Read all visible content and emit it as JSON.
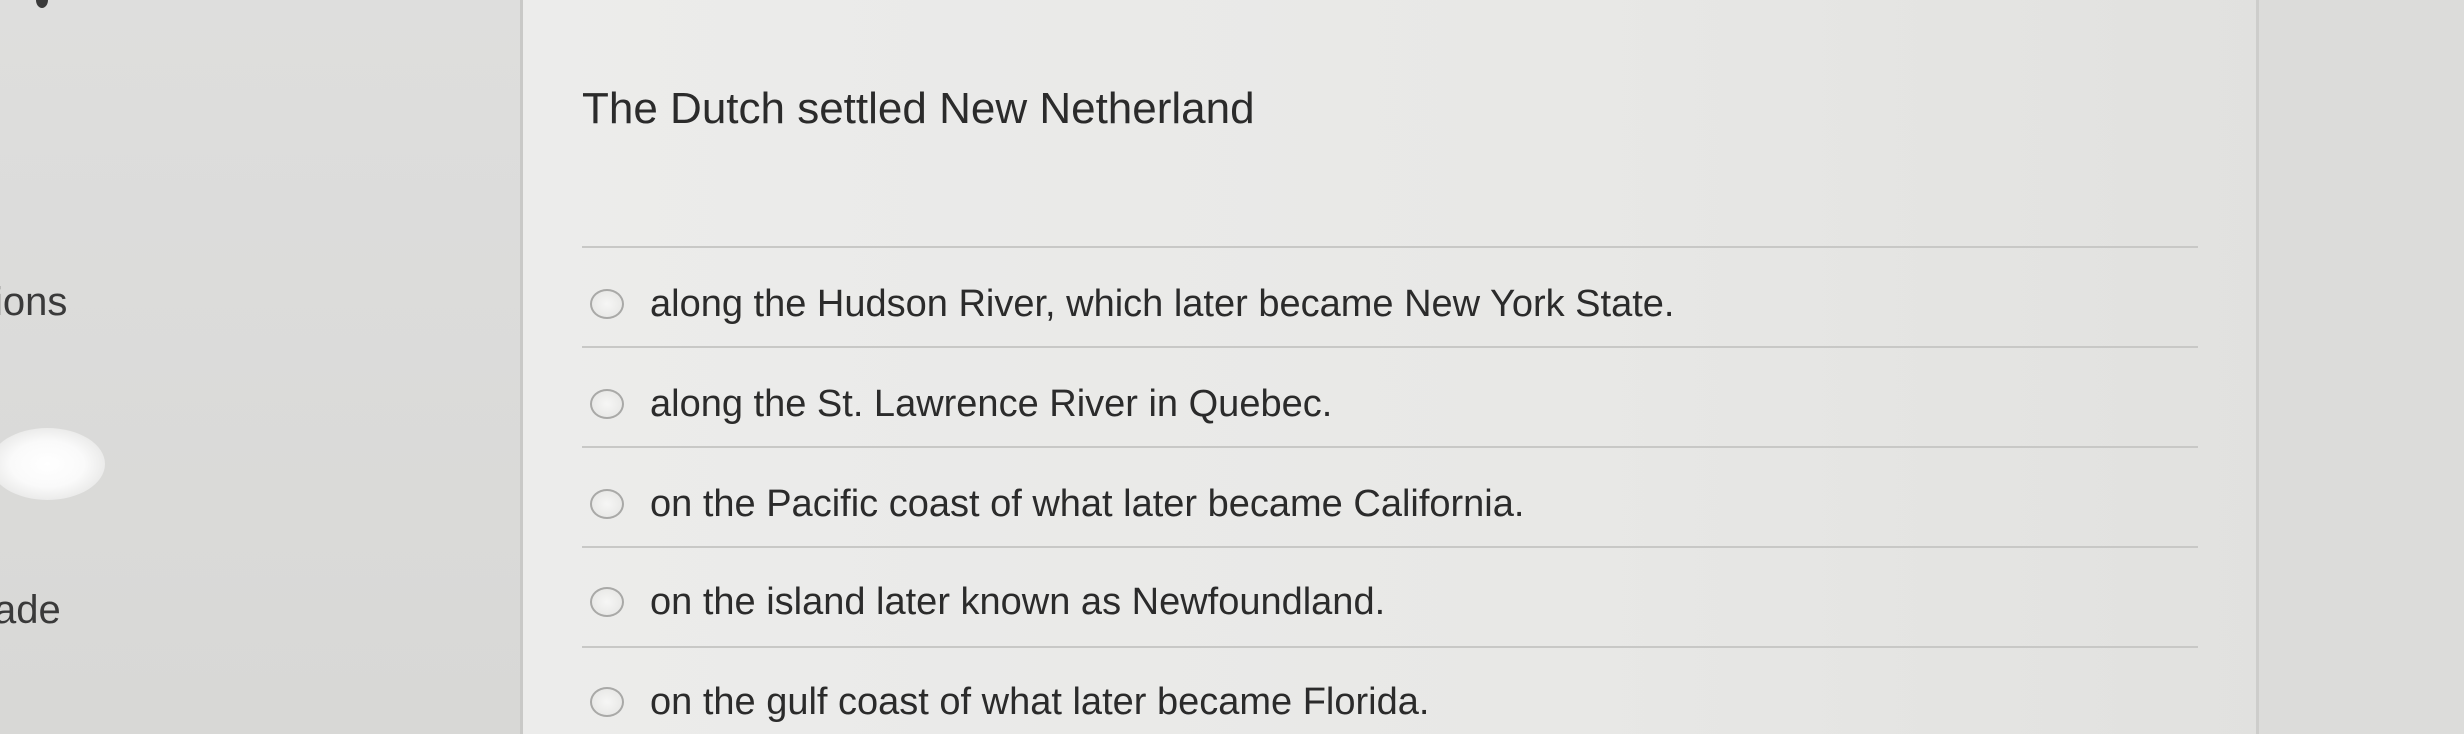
{
  "sidebar": {
    "labels": [
      "ions",
      "ade"
    ]
  },
  "question": {
    "text": "The Dutch settled New Netherland",
    "options": [
      {
        "label": "along the Hudson River, which later became New York State.",
        "selected": false
      },
      {
        "label": "along the St. Lawrence River in Quebec.",
        "selected": false
      },
      {
        "label": "on the Pacific coast of what later became California.",
        "selected": false
      },
      {
        "label": "on the island later known as Newfoundland.",
        "selected": false
      },
      {
        "label": "on the gulf coast of what later became Florida.",
        "selected": false
      }
    ]
  }
}
